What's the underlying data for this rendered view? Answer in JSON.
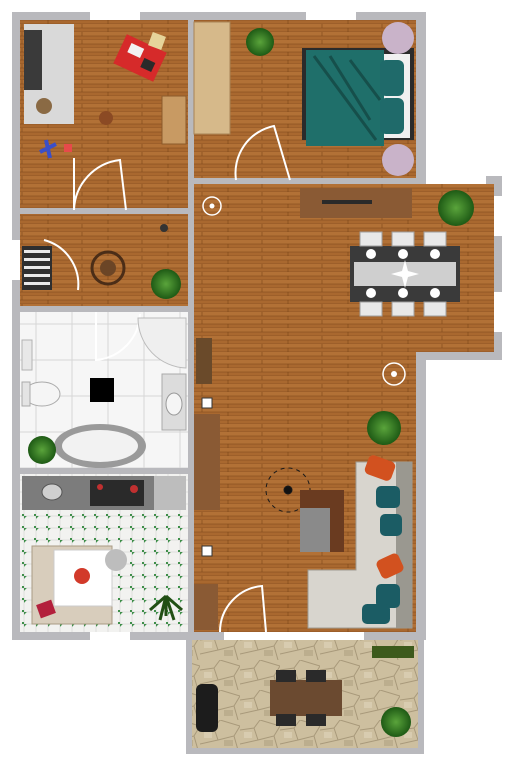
{
  "plan": {
    "rooms": [
      {
        "name": "playroom",
        "floor": "wood"
      },
      {
        "name": "bedroom",
        "floor": "wood"
      },
      {
        "name": "hallway",
        "floor": "wood"
      },
      {
        "name": "living-dining-room",
        "floor": "wood"
      },
      {
        "name": "bathroom",
        "floor": "white-tile"
      },
      {
        "name": "kitchen",
        "floor": "checker-tile"
      },
      {
        "name": "terrace",
        "floor": "stone"
      }
    ],
    "colors": {
      "wall": "#b9b9bd",
      "wood_base": "#a2622c",
      "wood_line": "#7a4418",
      "tile_white": "#f4f4f4",
      "checker_green": "#3f8f4a",
      "stone": "#cfc2a3",
      "sofa": "#d9d6cf",
      "bed_cover": "#1f6f6a",
      "pillow_orange": "#d2511f",
      "pillow_teal": "#1b5c64",
      "plant": "#2e7d1f",
      "rug_red": "#c8202a",
      "table_dark": "#2c2c2e",
      "chair": "#e6e6e6",
      "tv_panel": "#5a3a22"
    }
  }
}
